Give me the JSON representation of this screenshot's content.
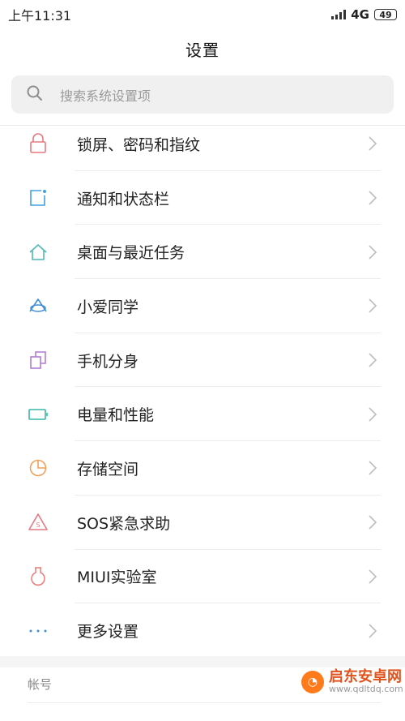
{
  "status_bar": {
    "time": "上午11:31",
    "network": "4G",
    "battery": "49"
  },
  "header": {
    "title": "设置"
  },
  "search": {
    "placeholder": "搜索系统设置项"
  },
  "settings_items": [
    {
      "label": "锁屏、密码和指纹",
      "icon": "lock-icon",
      "color": "#e8797f"
    },
    {
      "label": "通知和状态栏",
      "icon": "notification-icon",
      "color": "#3fa2e0"
    },
    {
      "label": "桌面与最近任务",
      "icon": "home-icon",
      "color": "#4fb8b3"
    },
    {
      "label": "小爱同学",
      "icon": "xiaoai-icon",
      "color": "#3f8fd6"
    },
    {
      "label": "手机分身",
      "icon": "second-space-icon",
      "color": "#b27bd6"
    },
    {
      "label": "电量和性能",
      "icon": "battery-icon",
      "color": "#35b8a7"
    },
    {
      "label": "存储空间",
      "icon": "storage-icon",
      "color": "#f2a05a"
    },
    {
      "label": "SOS紧急求助",
      "icon": "sos-icon",
      "color": "#e47a82"
    },
    {
      "label": "MIUI实验室",
      "icon": "lab-icon",
      "color": "#ef7f7f"
    },
    {
      "label": "更多设置",
      "icon": "more-icon",
      "color": "#3f8fd6"
    }
  ],
  "section": {
    "account_label": "帐号"
  },
  "watermark": {
    "title": "启东安卓网",
    "url": "www.qdltdq.com"
  }
}
